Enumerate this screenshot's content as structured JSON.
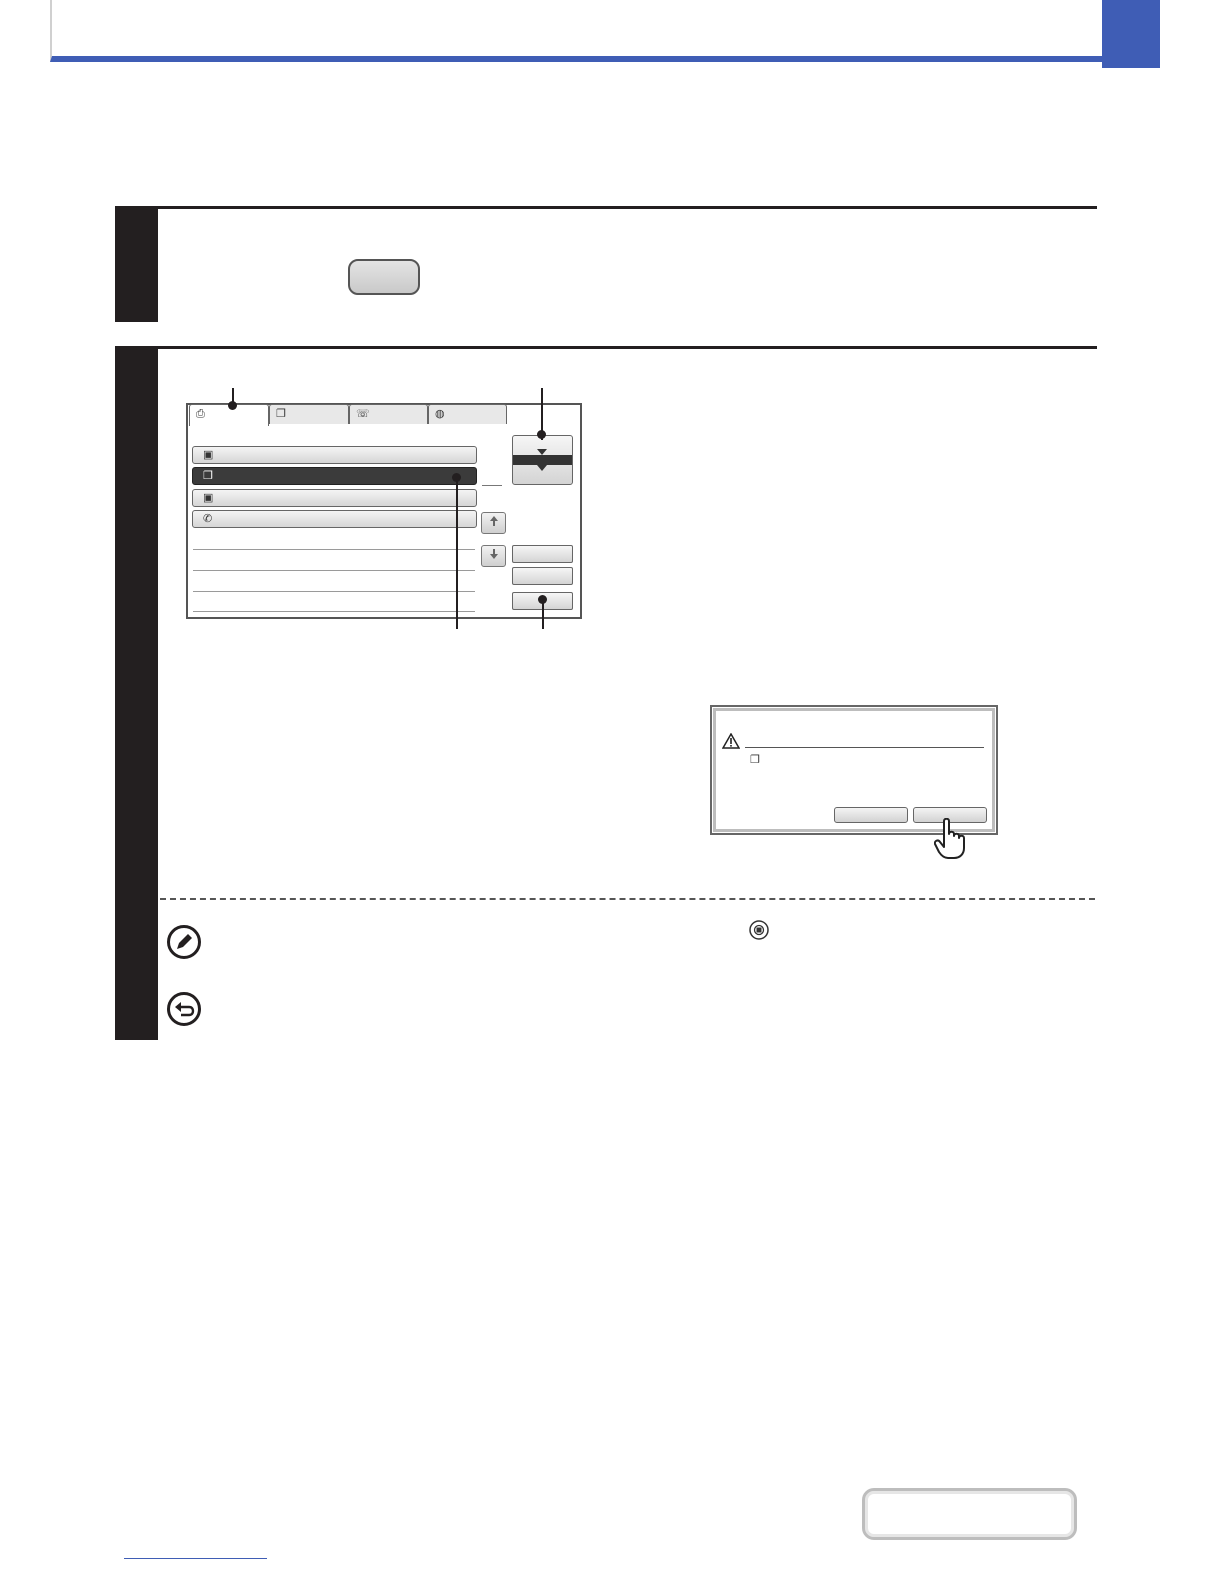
{
  "header": {
    "accent_color": "#3f5db5"
  },
  "steps": [
    {
      "number": ""
    },
    {
      "number": ""
    }
  ],
  "screen": {
    "tabs": [
      {
        "icon": "printer-icon"
      },
      {
        "icon": "copy-icon"
      },
      {
        "icon": "fax-icon"
      },
      {
        "icon": "internet-fax-icon"
      }
    ],
    "rows": [
      {
        "icon": "scanner-icon",
        "selected": false
      },
      {
        "icon": "copy-job-icon",
        "selected": true
      },
      {
        "icon": "scanner-icon",
        "selected": false
      },
      {
        "icon": "fax-job-icon",
        "selected": false
      }
    ]
  },
  "dialog": {
    "icon": "warning-icon"
  },
  "notes": [
    {
      "icon": "pencil-note-icon"
    },
    {
      "icon": "return-icon"
    }
  ]
}
